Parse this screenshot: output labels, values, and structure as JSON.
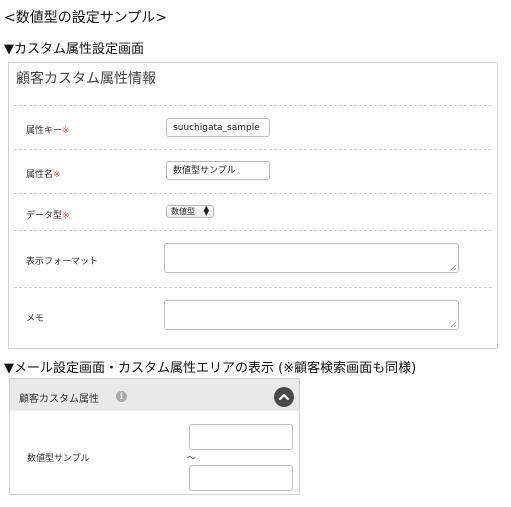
{
  "page_title": "<数値型の設定サンプル>",
  "section1_heading": "▼カスタム属性設定画面",
  "section2_heading": "▼メール設定画面・カスタム属性エリアの表示 (※顧客検索画面も同様)",
  "panel1": {
    "title": "顧客カスタム属性情報",
    "required_mark": "※",
    "fields": {
      "attr_key": {
        "label": "属性キー",
        "value": "suuchigata_sample"
      },
      "attr_name": {
        "label": "属性名",
        "value": "数値型サンプル"
      },
      "data_type": {
        "label": "データ型",
        "selected": "数値型"
      },
      "display_format": {
        "label": "表示フォーマット"
      },
      "memo": {
        "label": "メモ"
      }
    }
  },
  "panel2": {
    "title": "顧客カスタム属性",
    "info_icon": "i",
    "field_label": "数値型サンプル",
    "range_separator": "〜"
  },
  "colors": {
    "required": "#e6503c",
    "panel_header_bg": "#e9e9e9",
    "collapse_button": "#4a4a4a"
  },
  "icons": [
    "info-icon",
    "chevron-up-icon",
    "select-arrows-icon",
    "resize-grip-icon"
  ]
}
